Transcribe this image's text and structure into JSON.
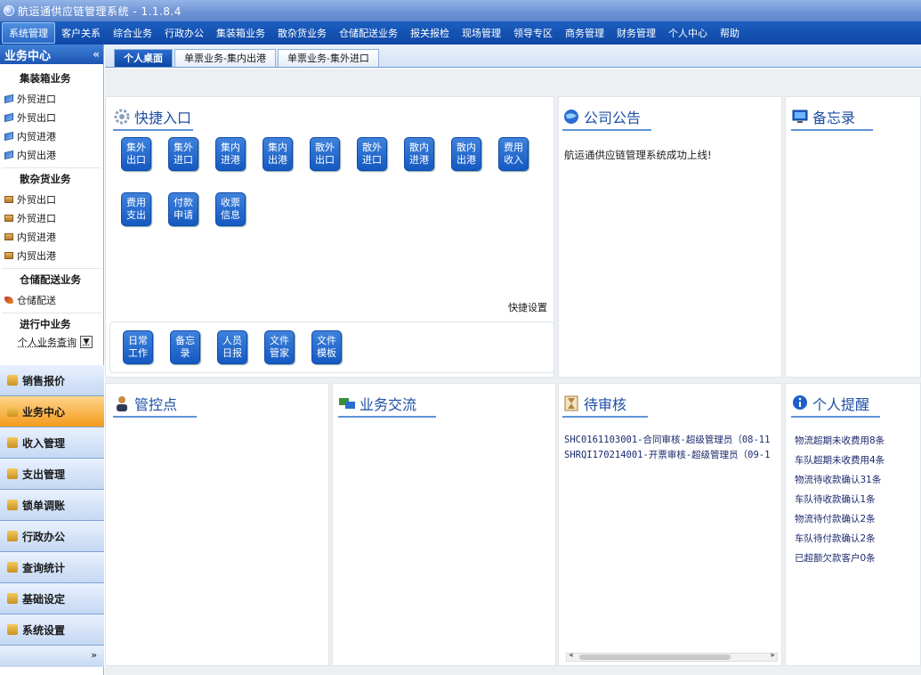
{
  "app": {
    "title": "航运通供应链管理系统 - 1.1.8.4"
  },
  "menu": [
    "系统管理",
    "客户关系",
    "综合业务",
    "行政办公",
    "集装箱业务",
    "散杂货业务",
    "仓储配送业务",
    "报关报检",
    "现场管理",
    "领导专区",
    "商务管理",
    "财务管理",
    "个人中心",
    "帮助"
  ],
  "sidebar": {
    "header": "业务中心",
    "collapse_icon": "«",
    "groups": [
      {
        "title": "集装箱业务",
        "icon": "container-icon",
        "items": [
          "外贸进口",
          "外贸出口",
          "内贸进港",
          "内贸出港"
        ]
      },
      {
        "title": "散杂货业务",
        "icon": "bulk-cargo-icon",
        "items": [
          "外贸出口",
          "外贸进口",
          "内贸进港",
          "内贸出港"
        ]
      },
      {
        "title": "仓储配送业务",
        "icon": "warehouse-icon",
        "items": [
          "仓储配送"
        ]
      }
    ],
    "progress_title": "进行中业务",
    "progress_select": "个人业务查询",
    "modules": [
      "销售报价",
      "业务中心",
      "收入管理",
      "支出管理",
      "锁单调账",
      "行政办公",
      "查询统计",
      "基础设定",
      "系统设置"
    ],
    "active_module": "业务中心",
    "expand_icon": "»"
  },
  "tabs": [
    "个人桌面",
    "单票业务-集内出港",
    "单票业务-集外进口"
  ],
  "quick": {
    "title": "快捷入口",
    "buttons": [
      "集外出口",
      "集外进口",
      "集内进港",
      "集内出港",
      "散外出口",
      "散外进口",
      "散内进港",
      "散内出港",
      "费用收入",
      "费用支出",
      "付款申请",
      "收票信息"
    ],
    "settings": "快捷设置",
    "bottom_buttons": [
      "日常工作",
      "备忘录",
      "人员日报",
      "文件管家",
      "文件模板"
    ]
  },
  "notice": {
    "title": "公司公告",
    "items": [
      "航运通供应链管理系统成功上线!"
    ]
  },
  "memo": {
    "title": "备忘录"
  },
  "control": {
    "title": "管控点"
  },
  "exchange": {
    "title": "业务交流"
  },
  "audit": {
    "title": "待审核",
    "items": [
      "SHC0161103001-合同审核-超级管理员（08-11",
      "SHRQI170214001-开票审核-超级管理员（09-1"
    ]
  },
  "reminders": {
    "title": "个人提醒",
    "items": [
      "物流超期未收费用8条",
      "车队超期未收费用4条",
      "物流待收款确认31条",
      "车队待收款确认1条",
      "物流待付款确认2条",
      "车队待付款确认2条",
      "已超额欠款客户0条"
    ]
  },
  "colors": {
    "menu_bg": "#1152b3",
    "accent": "#1d4fa5",
    "active_module": "#f5a623"
  }
}
